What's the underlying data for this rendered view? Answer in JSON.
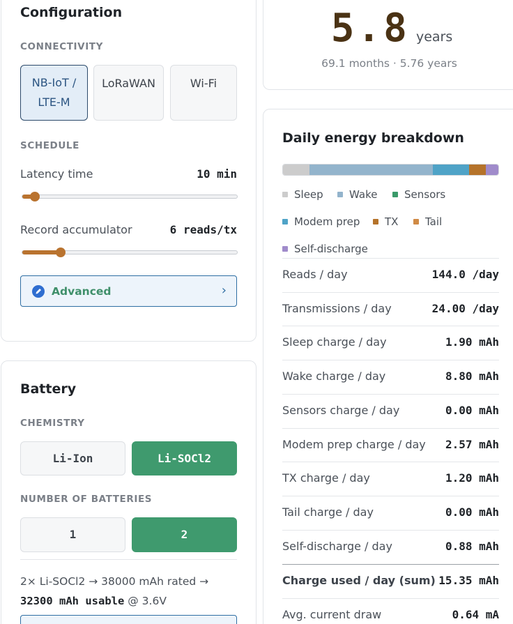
{
  "configuration": {
    "title": "Configuration",
    "connectivity": {
      "label": "CONNECTIVITY",
      "options": [
        {
          "line1": "NB-IoT /",
          "line2": "LTE-M",
          "selected": true
        },
        {
          "line1": "LoRaWAN",
          "line2": "",
          "selected": false
        },
        {
          "line1": "Wi-Fi",
          "line2": "",
          "selected": false
        }
      ]
    },
    "schedule": {
      "label": "SCHEDULE",
      "latency": {
        "label": "Latency time",
        "value": "10 min",
        "level_pct": 6
      },
      "accumulator": {
        "label": "Record accumulator",
        "value": "6 reads/tx",
        "level_pct": 18
      }
    },
    "advanced": {
      "label": "Advanced",
      "icon": "pencil-icon",
      "chevron": "›"
    }
  },
  "battery": {
    "title": "Battery",
    "chemistry": {
      "label": "CHEMISTRY",
      "options": [
        {
          "label": "Li-Ion",
          "selected": false
        },
        {
          "label": "Li-SOCl2",
          "selected": true
        }
      ]
    },
    "count": {
      "label": "NUMBER OF BATTERIES",
      "options": [
        {
          "label": "1",
          "selected": false
        },
        {
          "label": "2",
          "selected": true
        }
      ]
    },
    "summary": {
      "prefix": "2× Li-SOCl2 → 38000 mAh rated →",
      "usable": "32300 mAh usable",
      "suffix": "@ 3.6V"
    }
  },
  "lifetime": {
    "value": "5.8",
    "unit": "years",
    "sub": "69.1 months · 5.76 years"
  },
  "energy": {
    "title": "Daily energy breakdown",
    "bar_segments": [
      {
        "name": "Sleep",
        "fraction": 0.124,
        "color": "#cccccc"
      },
      {
        "name": "Wake",
        "fraction": 0.573,
        "color": "#93b4cc"
      },
      {
        "name": "Sensors",
        "fraction": 0.0,
        "color": "#3a9a6a"
      },
      {
        "name": "Modem prep",
        "fraction": 0.167,
        "color": "#4fa3c7"
      },
      {
        "name": "TX",
        "fraction": 0.078,
        "color": "#b5732a"
      },
      {
        "name": "Tail",
        "fraction": 0.0,
        "color": "#d08a45"
      },
      {
        "name": "Self-discharge",
        "fraction": 0.058,
        "color": "#a08bcb"
      }
    ],
    "legend": [
      {
        "name": "Sleep",
        "color": "#cccccc"
      },
      {
        "name": "Wake",
        "color": "#93b4cc"
      },
      {
        "name": "Sensors",
        "color": "#3a9a6a"
      },
      {
        "name": "Modem prep",
        "color": "#4fa3c7"
      },
      {
        "name": "TX",
        "color": "#b5732a"
      },
      {
        "name": "Tail",
        "color": "#d08a45"
      },
      {
        "name": "Self-discharge",
        "color": "#a08bcb"
      }
    ],
    "rows": [
      {
        "label": "Reads / day",
        "value": "144.0 /day"
      },
      {
        "label": "Transmissions / day",
        "value": "24.00 /day"
      },
      {
        "label": "Sleep charge / day",
        "value": "1.90 mAh"
      },
      {
        "label": "Wake charge / day",
        "value": "8.80 mAh"
      },
      {
        "label": "Sensors charge / day",
        "value": "0.00 mAh"
      },
      {
        "label": "Modem prep charge / day",
        "value": "2.57 mAh"
      },
      {
        "label": "TX charge / day",
        "value": "1.20 mAh"
      },
      {
        "label": "Tail charge / day",
        "value": "0.00 mAh"
      },
      {
        "label": "Self-discharge / day",
        "value": "0.88 mAh"
      },
      {
        "label": "Charge used / day (sum)",
        "value": "15.35 mAh",
        "bold": true
      },
      {
        "label": "Avg. current draw",
        "value": "0.64 mA"
      }
    ]
  }
}
